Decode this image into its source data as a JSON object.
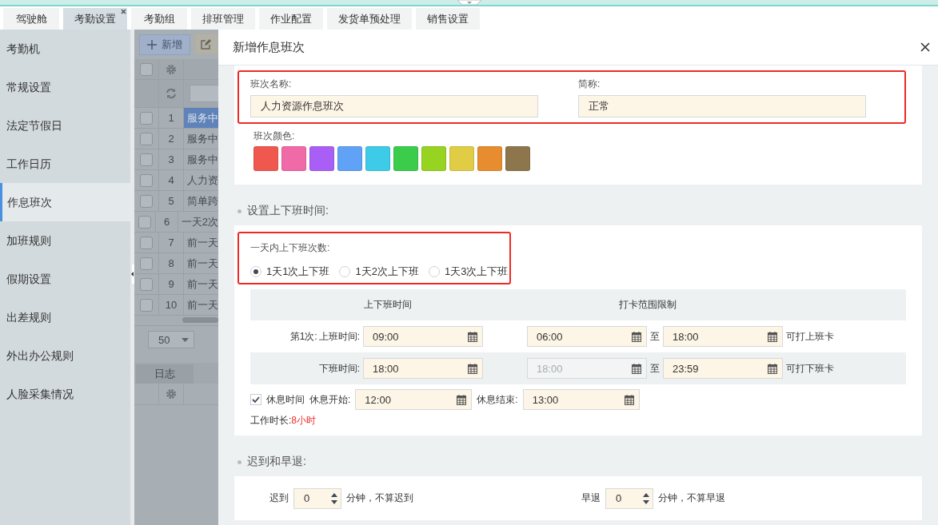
{
  "top_tabs": [
    {
      "label": "驾驶舱",
      "selected": false,
      "closable": false
    },
    {
      "label": "考勤设置",
      "selected": true,
      "closable": true
    },
    {
      "label": "考勤组",
      "selected": false,
      "closable": false
    },
    {
      "label": "排班管理",
      "selected": false,
      "closable": false
    },
    {
      "label": "作业配置",
      "selected": false,
      "closable": false
    },
    {
      "label": "发货单预处理",
      "selected": false,
      "closable": false
    },
    {
      "label": "销售设置",
      "selected": false,
      "closable": false
    }
  ],
  "sidebar": {
    "items": [
      {
        "label": "考勤机",
        "selected": false
      },
      {
        "label": "常规设置",
        "selected": false
      },
      {
        "label": "法定节假日",
        "selected": false
      },
      {
        "label": "工作日历",
        "selected": false
      },
      {
        "label": "作息班次",
        "selected": true
      },
      {
        "label": "加班规则",
        "selected": false
      },
      {
        "label": "假期设置",
        "selected": false
      },
      {
        "label": "出差规则",
        "selected": false
      },
      {
        "label": "外出办公规则",
        "selected": false
      },
      {
        "label": "人脸采集情况",
        "selected": false
      }
    ]
  },
  "background_grid": {
    "add_button": "新增",
    "select_all_checked": false,
    "rows": [
      {
        "index": "1",
        "name": "服务中",
        "selected": true,
        "checked": false
      },
      {
        "index": "2",
        "name": "服务中",
        "selected": false,
        "checked": false
      },
      {
        "index": "3",
        "name": "服务中",
        "selected": false,
        "checked": false
      },
      {
        "index": "4",
        "name": "人力资",
        "selected": false,
        "checked": false
      },
      {
        "index": "5",
        "name": "简单跨",
        "selected": false,
        "checked": false
      },
      {
        "index": "6",
        "name": "一天2次",
        "selected": false,
        "checked": false
      },
      {
        "index": "7",
        "name": "前一天",
        "selected": false,
        "checked": false
      },
      {
        "index": "8",
        "name": "前一天",
        "selected": false,
        "checked": false
      },
      {
        "index": "9",
        "name": "前一天",
        "selected": false,
        "checked": false
      },
      {
        "index": "10",
        "name": "前一天",
        "selected": false,
        "checked": false
      }
    ],
    "page_size": "50",
    "log_tab": "日志"
  },
  "dialog": {
    "title": "新增作息班次",
    "name_field": {
      "label": "班次名称:",
      "value": "人力资源作息班次"
    },
    "short_field": {
      "label": "简称:",
      "value": "正常"
    },
    "color_label": "班次颜色:",
    "colors": [
      {
        "color": "#f0584f"
      },
      {
        "color": "#f06aa8"
      },
      {
        "color": "#a95ff6"
      },
      {
        "color": "#60a2f5"
      },
      {
        "color": "#3ecbe8"
      },
      {
        "color": "#3ccc4b"
      },
      {
        "color": "#97d321"
      },
      {
        "color": "#e1cc45"
      },
      {
        "color": "#e78d2f"
      },
      {
        "color": "#8d764b"
      }
    ],
    "time_section": {
      "title": "设置上下班时间:",
      "count_label": "一天内上下班次数:",
      "options": [
        {
          "label": "1天1次上下班",
          "selected": true
        },
        {
          "label": "1天2次上下班",
          "selected": false
        },
        {
          "label": "1天3次上下班",
          "selected": false
        }
      ],
      "headers": [
        "上下班时间",
        "打卡范围限制"
      ],
      "rows": [
        {
          "prefix": "第1次:",
          "label": "上班时间:",
          "time": "09:00",
          "range_from": "06:00",
          "range_from_disabled": false,
          "to_label": "至",
          "range_to": "18:00",
          "note": "可打上班卡"
        },
        {
          "label": "下班时间:",
          "time": "18:00",
          "range_from": "18:00",
          "range_from_disabled": true,
          "to_label": "至",
          "range_to": "23:59",
          "note": "可打下班卡"
        }
      ],
      "break": {
        "checked": true,
        "label": "休息时间",
        "start_label": "休息开始:",
        "start": "12:00",
        "end_label": "休息结束:",
        "end": "13:00"
      },
      "duration": {
        "label": "工作时长:",
        "value": "8小时"
      }
    },
    "late_section": {
      "title": "迟到和早退:",
      "items": [
        {
          "label": "迟到",
          "value": "0",
          "suffix": "分钟，不算迟到"
        },
        {
          "label": "早退",
          "value": "0",
          "suffix": "分钟，不算早退"
        }
      ]
    }
  }
}
